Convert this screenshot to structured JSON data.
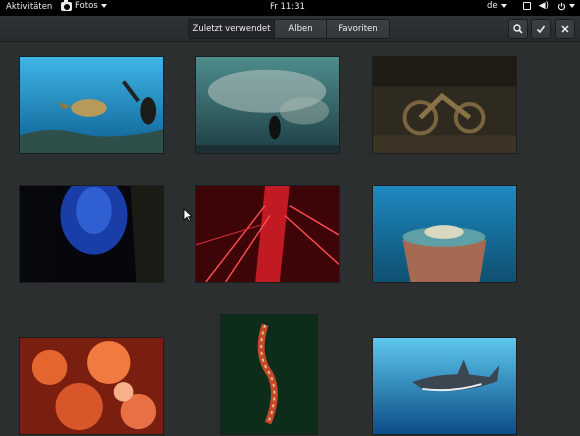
{
  "topbar": {
    "activities": "Aktivitäten",
    "app_name": "Fotos",
    "clock": "Fr 11:31",
    "keyboard_layout": "de"
  },
  "header": {
    "tabs": [
      {
        "label": "Zuletzt verwendet",
        "active": true
      },
      {
        "label": "Alben",
        "active": false
      },
      {
        "label": "Favoriten",
        "active": false
      }
    ],
    "search_icon": "search-icon",
    "select_icon": "checkmark-icon",
    "close_icon": "close-icon"
  },
  "photos": [
    {
      "subject": "diver with sea turtle"
    },
    {
      "subject": "diver in school of fish"
    },
    {
      "subject": "motorcycle wreck"
    },
    {
      "subject": "underwater cave"
    },
    {
      "subject": "red sea urchin spines"
    },
    {
      "subject": "barrel sponge with fish"
    },
    {
      "subject": "orange soft coral"
    },
    {
      "subject": "ghost pipefish"
    },
    {
      "subject": "oceanic whitetip shark"
    }
  ]
}
